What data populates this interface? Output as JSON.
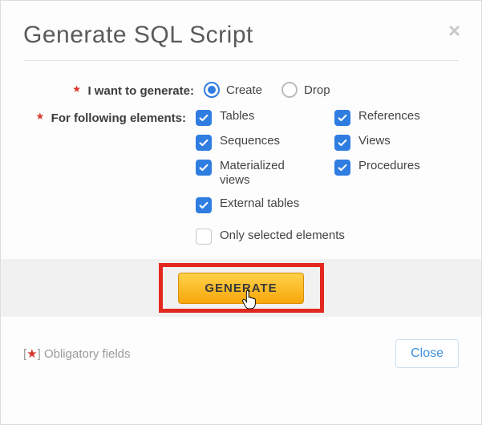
{
  "title": "Generate SQL Script",
  "close_icon_name": "close-icon",
  "labels": {
    "want": "I want to generate:",
    "elements": "For following elements:"
  },
  "radios": {
    "create": {
      "label": "Create",
      "selected": true
    },
    "drop": {
      "label": "Drop",
      "selected": false
    }
  },
  "checks_left": [
    {
      "name": "tables",
      "label": "Tables",
      "checked": true
    },
    {
      "name": "sequences",
      "label": "Sequences",
      "checked": true
    },
    {
      "name": "matviews",
      "label": "Materialized views",
      "checked": true
    },
    {
      "name": "exttables",
      "label": "External tables",
      "checked": true
    }
  ],
  "checks_right": [
    {
      "name": "references",
      "label": "References",
      "checked": true
    },
    {
      "name": "views",
      "label": "Views",
      "checked": true
    },
    {
      "name": "procedures",
      "label": "Procedures",
      "checked": true
    }
  ],
  "only_selected": {
    "label": "Only selected elements",
    "checked": false
  },
  "buttons": {
    "generate": "GENERATE",
    "close": "Close"
  },
  "footer_note": {
    "left_bracket": "[",
    "star": "★",
    "right_bracket": "] ",
    "text": "Obligatory fields"
  },
  "colors": {
    "accent": "#2f7de1",
    "danger": "#d9332b",
    "highlight": "#e2281f",
    "button_grad_top": "#ffd24a",
    "button_grad_bot": "#f7a60b"
  }
}
